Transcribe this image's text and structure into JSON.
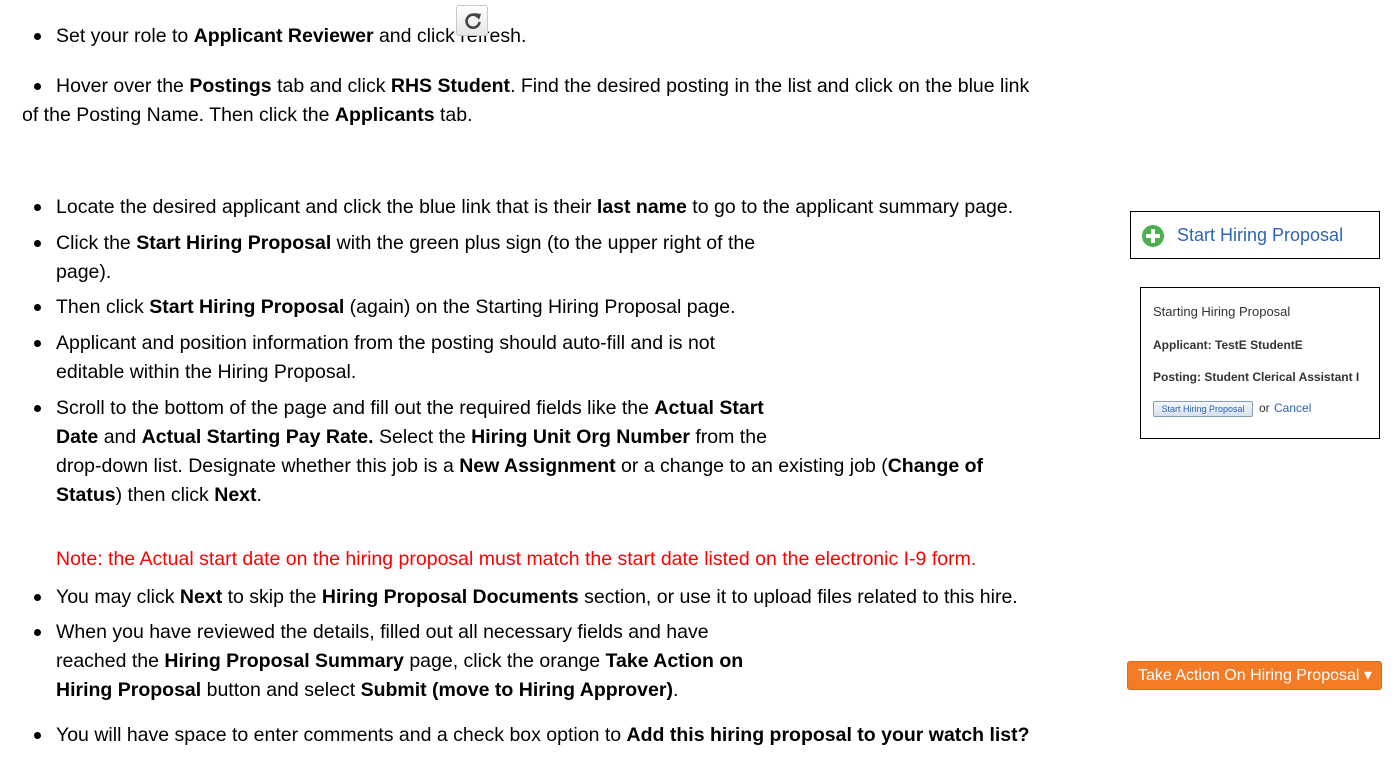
{
  "instructions": {
    "line1": {
      "a": "Set your role to ",
      "b1": "Applicant Reviewer",
      "c": " and click refresh."
    },
    "line2": {
      "a": "Hover over the ",
      "b1": "Postings",
      "c": " tab and click ",
      "b2": "RHS Student",
      "d": ". Find the desired posting in the list and click on the blue link"
    },
    "line3": {
      "a": "of the Posting Name. Then click the ",
      "b1": "Applicants",
      "c": " tab."
    },
    "line4": {
      "a": "Locate the desired applicant and click the blue link that is their ",
      "b1": "last name",
      "c": " to go to the applicant summary page."
    },
    "line5": {
      "a": "Click the ",
      "b1": "Start Hiring Proposal",
      "c": " with the green plus sign (to the upper right of the"
    },
    "line6": {
      "a": "page)."
    },
    "line7": {
      "a": "Then click ",
      "b1": "Start Hiring Proposal",
      "c": " (again) on the Starting Hiring Proposal page."
    },
    "line8": {
      "a": "Applicant and position information from the posting should auto-fill and is not"
    },
    "line9": {
      "a": "editable within the Hiring Proposal."
    },
    "line10": {
      "a": "Scroll to the bottom of the page and fill out the required fields like the ",
      "b1": "Actual Start"
    },
    "line11": {
      "b0": "Date",
      "a": " and ",
      "b1": "Actual Starting Pay Rate.",
      "c": " Select the ",
      "b2": "Hiring Unit Org Number",
      "d": " from the"
    },
    "line12": {
      "a": "drop-down list. Designate whether this job is a ",
      "b1": "New Assignment",
      "c": " or a change to an existing job (",
      "b2": "Change of"
    },
    "line13": {
      "b0": "Status",
      "a": ") then click ",
      "b1": "Next",
      "c": "."
    },
    "note": "Note: the Actual start date on the hiring proposal must match the start date listed on the electronic I-9 form.",
    "line14": {
      "a": "You may click ",
      "b1": "Next",
      "c": " to skip the ",
      "b2": "Hiring Proposal Documents",
      "d": " section, or use it to upload files related to this hire."
    },
    "line15": {
      "a": "When you have reviewed the details, filled out all necessary fields and have"
    },
    "line16": {
      "a": "reached the ",
      "b1": "Hiring Proposal Summary",
      "c": " page, click the orange ",
      "b2": "Take Action on"
    },
    "line17": {
      "b0": "Hiring Proposal",
      "a": " button and select ",
      "b1": "Submit (move to Hiring Approver)",
      "c": "."
    },
    "line18": {
      "a": "You will have space to enter comments and a check box option to ",
      "b1": "Add this hiring proposal to your watch list?"
    }
  },
  "start_hiring_button": {
    "label": "Start Hiring Proposal",
    "icon": "green-plus-icon"
  },
  "panel": {
    "title": "Starting Hiring Proposal",
    "applicant": "Applicant: TestE StudentE",
    "posting": "Posting: Student Clerical Assistant I",
    "button": "Start Hiring Proposal",
    "or": "or",
    "cancel": "Cancel"
  },
  "take_action": {
    "label": "Take Action On Hiring Proposal ▾"
  },
  "colors": {
    "link_blue": "#2f64b5",
    "note_red": "#ff0000",
    "orange": "#f47b26",
    "green": "#4caf50"
  }
}
